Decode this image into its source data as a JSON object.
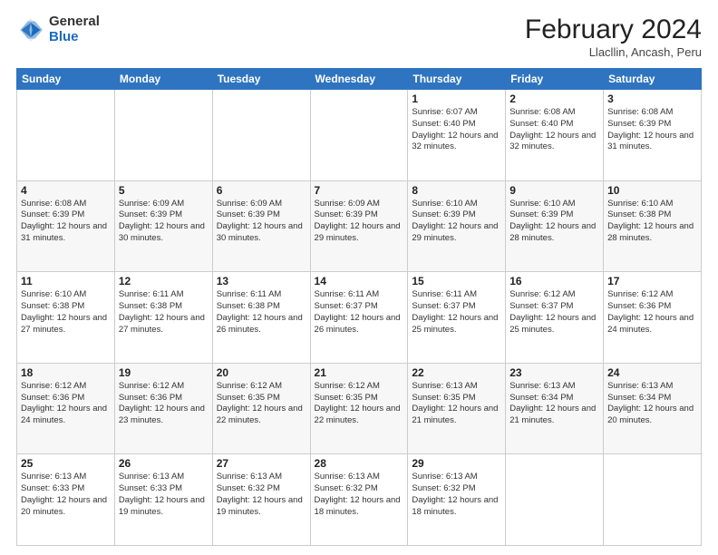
{
  "header": {
    "logo_general": "General",
    "logo_blue": "Blue",
    "month_year": "February 2024",
    "location": "Llacllin, Ancash, Peru"
  },
  "days_of_week": [
    "Sunday",
    "Monday",
    "Tuesday",
    "Wednesday",
    "Thursday",
    "Friday",
    "Saturday"
  ],
  "weeks": [
    [
      {
        "num": "",
        "info": ""
      },
      {
        "num": "",
        "info": ""
      },
      {
        "num": "",
        "info": ""
      },
      {
        "num": "",
        "info": ""
      },
      {
        "num": "1",
        "info": "Sunrise: 6:07 AM\nSunset: 6:40 PM\nDaylight: 12 hours and 32 minutes."
      },
      {
        "num": "2",
        "info": "Sunrise: 6:08 AM\nSunset: 6:40 PM\nDaylight: 12 hours and 32 minutes."
      },
      {
        "num": "3",
        "info": "Sunrise: 6:08 AM\nSunset: 6:39 PM\nDaylight: 12 hours and 31 minutes."
      }
    ],
    [
      {
        "num": "4",
        "info": "Sunrise: 6:08 AM\nSunset: 6:39 PM\nDaylight: 12 hours and 31 minutes."
      },
      {
        "num": "5",
        "info": "Sunrise: 6:09 AM\nSunset: 6:39 PM\nDaylight: 12 hours and 30 minutes."
      },
      {
        "num": "6",
        "info": "Sunrise: 6:09 AM\nSunset: 6:39 PM\nDaylight: 12 hours and 30 minutes."
      },
      {
        "num": "7",
        "info": "Sunrise: 6:09 AM\nSunset: 6:39 PM\nDaylight: 12 hours and 29 minutes."
      },
      {
        "num": "8",
        "info": "Sunrise: 6:10 AM\nSunset: 6:39 PM\nDaylight: 12 hours and 29 minutes."
      },
      {
        "num": "9",
        "info": "Sunrise: 6:10 AM\nSunset: 6:39 PM\nDaylight: 12 hours and 28 minutes."
      },
      {
        "num": "10",
        "info": "Sunrise: 6:10 AM\nSunset: 6:38 PM\nDaylight: 12 hours and 28 minutes."
      }
    ],
    [
      {
        "num": "11",
        "info": "Sunrise: 6:10 AM\nSunset: 6:38 PM\nDaylight: 12 hours and 27 minutes."
      },
      {
        "num": "12",
        "info": "Sunrise: 6:11 AM\nSunset: 6:38 PM\nDaylight: 12 hours and 27 minutes."
      },
      {
        "num": "13",
        "info": "Sunrise: 6:11 AM\nSunset: 6:38 PM\nDaylight: 12 hours and 26 minutes."
      },
      {
        "num": "14",
        "info": "Sunrise: 6:11 AM\nSunset: 6:37 PM\nDaylight: 12 hours and 26 minutes."
      },
      {
        "num": "15",
        "info": "Sunrise: 6:11 AM\nSunset: 6:37 PM\nDaylight: 12 hours and 25 minutes."
      },
      {
        "num": "16",
        "info": "Sunrise: 6:12 AM\nSunset: 6:37 PM\nDaylight: 12 hours and 25 minutes."
      },
      {
        "num": "17",
        "info": "Sunrise: 6:12 AM\nSunset: 6:36 PM\nDaylight: 12 hours and 24 minutes."
      }
    ],
    [
      {
        "num": "18",
        "info": "Sunrise: 6:12 AM\nSunset: 6:36 PM\nDaylight: 12 hours and 24 minutes."
      },
      {
        "num": "19",
        "info": "Sunrise: 6:12 AM\nSunset: 6:36 PM\nDaylight: 12 hours and 23 minutes."
      },
      {
        "num": "20",
        "info": "Sunrise: 6:12 AM\nSunset: 6:35 PM\nDaylight: 12 hours and 22 minutes."
      },
      {
        "num": "21",
        "info": "Sunrise: 6:12 AM\nSunset: 6:35 PM\nDaylight: 12 hours and 22 minutes."
      },
      {
        "num": "22",
        "info": "Sunrise: 6:13 AM\nSunset: 6:35 PM\nDaylight: 12 hours and 21 minutes."
      },
      {
        "num": "23",
        "info": "Sunrise: 6:13 AM\nSunset: 6:34 PM\nDaylight: 12 hours and 21 minutes."
      },
      {
        "num": "24",
        "info": "Sunrise: 6:13 AM\nSunset: 6:34 PM\nDaylight: 12 hours and 20 minutes."
      }
    ],
    [
      {
        "num": "25",
        "info": "Sunrise: 6:13 AM\nSunset: 6:33 PM\nDaylight: 12 hours and 20 minutes."
      },
      {
        "num": "26",
        "info": "Sunrise: 6:13 AM\nSunset: 6:33 PM\nDaylight: 12 hours and 19 minutes."
      },
      {
        "num": "27",
        "info": "Sunrise: 6:13 AM\nSunset: 6:32 PM\nDaylight: 12 hours and 19 minutes."
      },
      {
        "num": "28",
        "info": "Sunrise: 6:13 AM\nSunset: 6:32 PM\nDaylight: 12 hours and 18 minutes."
      },
      {
        "num": "29",
        "info": "Sunrise: 6:13 AM\nSunset: 6:32 PM\nDaylight: 12 hours and 18 minutes."
      },
      {
        "num": "",
        "info": ""
      },
      {
        "num": "",
        "info": ""
      }
    ]
  ]
}
